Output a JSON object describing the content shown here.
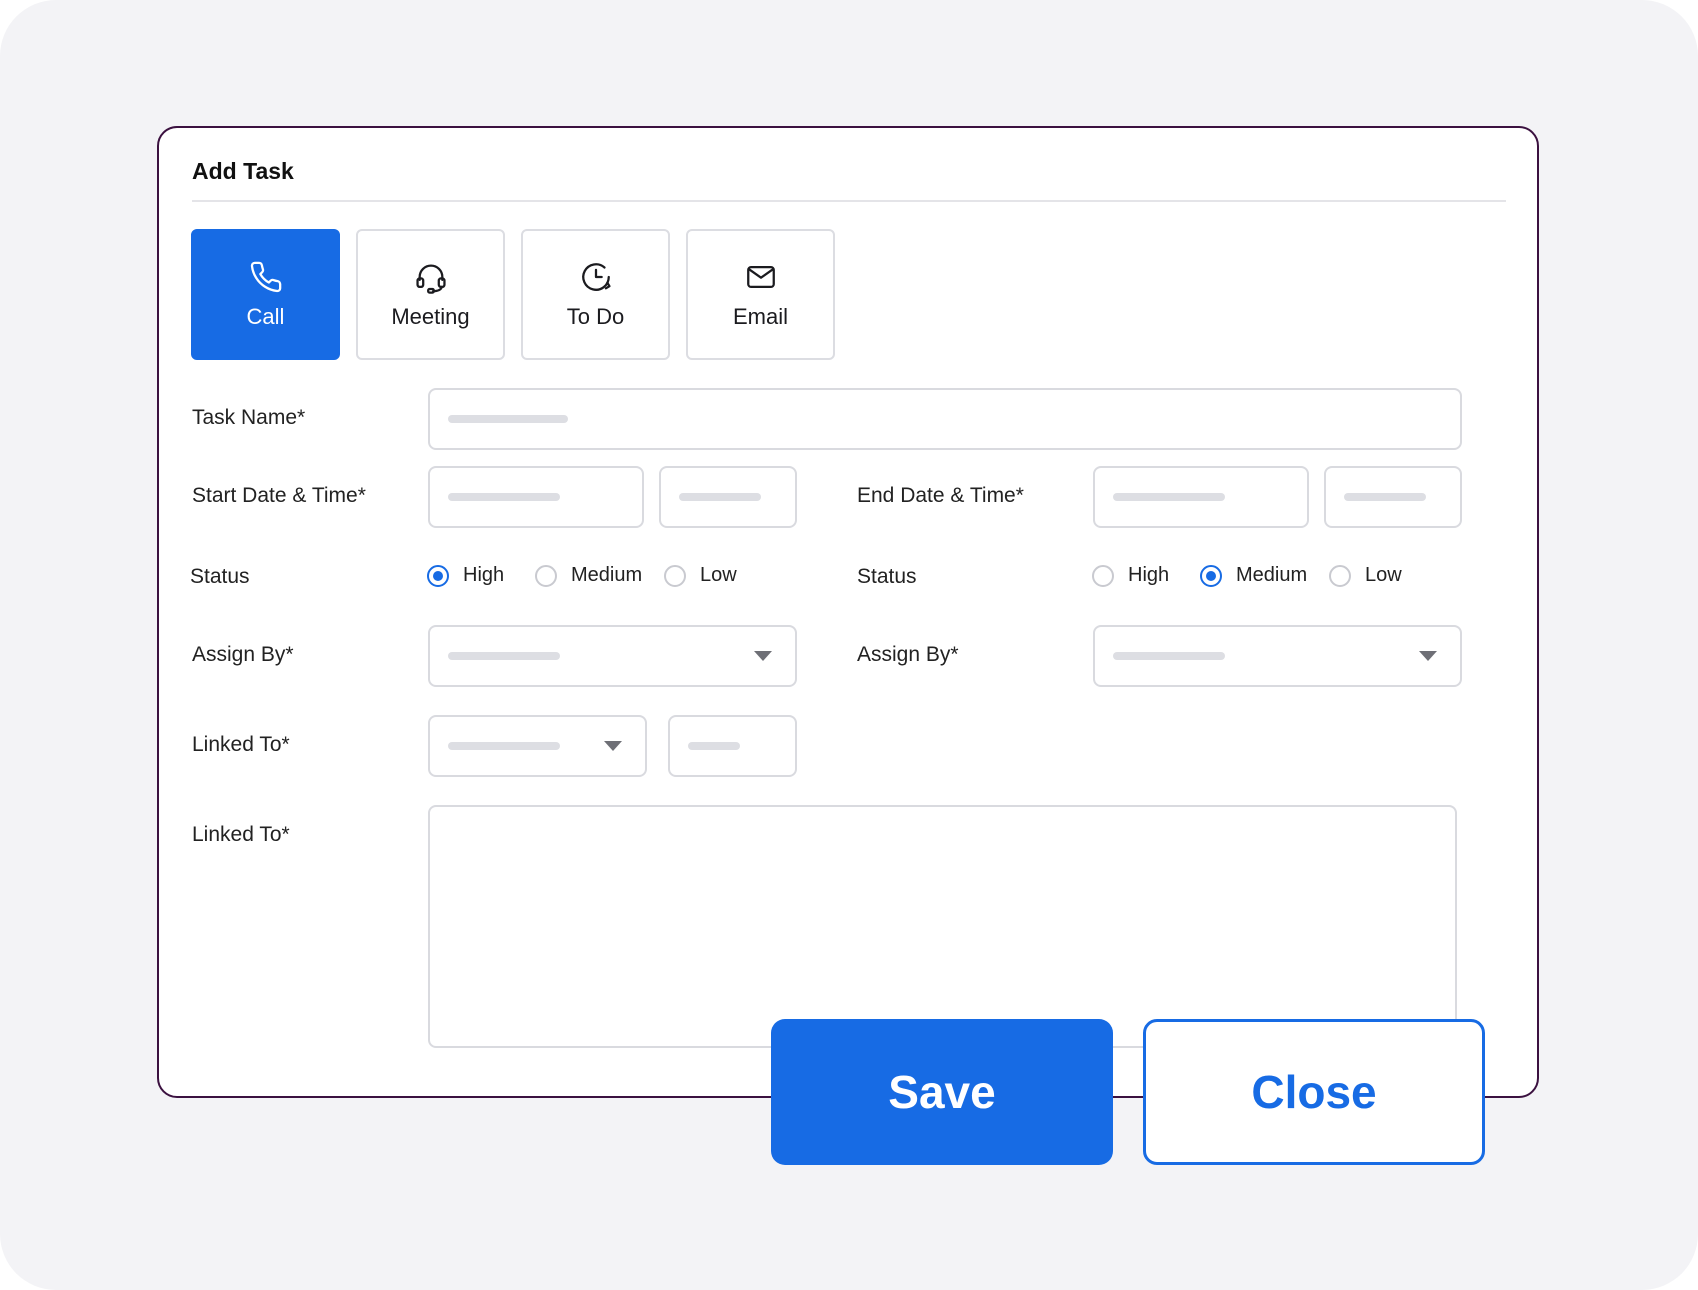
{
  "dialog": {
    "title": "Add Task"
  },
  "tabs": [
    {
      "label": "Call",
      "icon": "phone-icon",
      "active": true
    },
    {
      "label": "Meeting",
      "icon": "headset-icon",
      "active": false
    },
    {
      "label": "To Do",
      "icon": "clock-icon",
      "active": false
    },
    {
      "label": "Email",
      "icon": "mail-icon",
      "active": false
    }
  ],
  "form": {
    "task_name_label": "Task Name*",
    "start_label": "Start Date & Time*",
    "end_label": "End Date & Time*",
    "status_left_label": "Status",
    "status_right_label": "Status",
    "status_left_options": [
      "High",
      "Medium",
      "Low"
    ],
    "status_left_selected": "High",
    "status_right_options": [
      "High",
      "Medium",
      "Low"
    ],
    "status_right_selected": "Medium",
    "assign_left_label": "Assign By*",
    "assign_right_label": "Assign By*",
    "linked_label": "Linked To*",
    "linked_notes_label": "Linked To*"
  },
  "actions": {
    "save_label": "Save",
    "close_label": "Close"
  },
  "colors": {
    "accent": "#176be4",
    "dialog_border": "#3b1140"
  }
}
